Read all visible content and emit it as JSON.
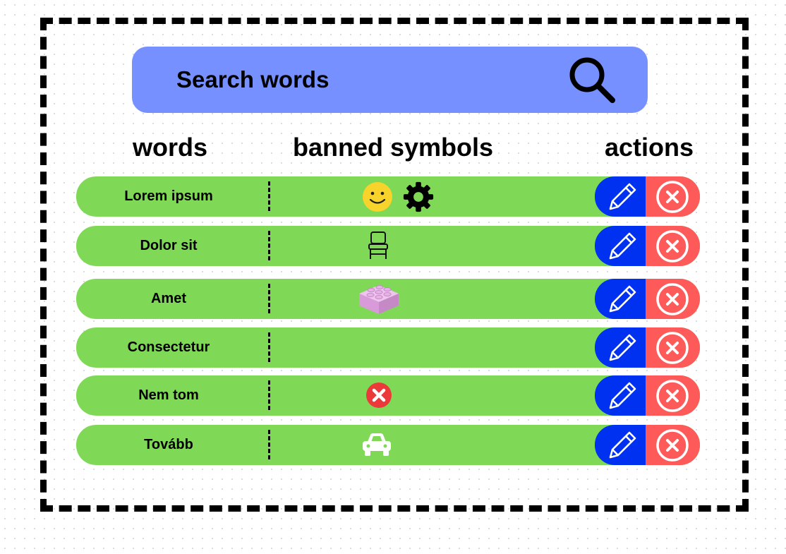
{
  "search": {
    "label": "Search words",
    "icon": "search-icon"
  },
  "headers": {
    "words": "words",
    "symbols": "banned symbols",
    "actions": "actions"
  },
  "rows": [
    {
      "word": "Lorem ipsum",
      "symbols": [
        "smiley-face-icon",
        "gear-icon"
      ]
    },
    {
      "word": "Dolor sit",
      "symbols": [
        "chair-icon"
      ]
    },
    {
      "word": "Amet",
      "symbols": [
        "lego-brick-icon"
      ]
    },
    {
      "word": "Consectetur",
      "symbols": []
    },
    {
      "word": "Nem tom",
      "symbols": [
        "red-x-icon"
      ]
    },
    {
      "word": "Tovább",
      "symbols": [
        "car-icon"
      ]
    }
  ],
  "actions": {
    "edit": "pencil-icon",
    "delete": "close-circle-icon"
  },
  "colors": {
    "search_bg": "#7690ff",
    "row_bg": "#7fd957",
    "edit_bg": "#0030f0",
    "delete_bg": "#ff5a5a"
  }
}
